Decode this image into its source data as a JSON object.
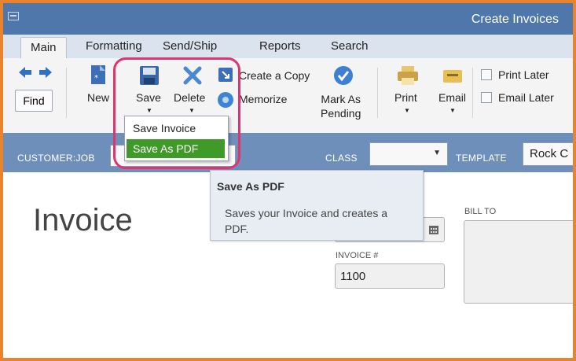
{
  "window": {
    "title": "Create Invoices"
  },
  "tabs": [
    {
      "label": "Main"
    },
    {
      "label": "Formatting"
    },
    {
      "label": "Send/Ship"
    },
    {
      "label": "Reports"
    },
    {
      "label": "Search"
    }
  ],
  "ribbon": {
    "find": "Find",
    "new": "New",
    "save": "Save",
    "delete": "Delete",
    "create_copy": "Create a Copy",
    "memorize": "Memorize",
    "mark_as_pending": [
      "Mark As",
      "Pending"
    ],
    "print": "Print",
    "email": "Email",
    "print_later": "Print Later",
    "email_later": "Email Later"
  },
  "save_menu": {
    "items": [
      {
        "label": "Save Invoice"
      },
      {
        "label": "Save As PDF"
      }
    ],
    "highlighted": "Save As PDF"
  },
  "tooltip": {
    "title": "Save As PDF",
    "body": "Saves your Invoice and creates a PDF."
  },
  "header": {
    "customer_job_label": "CUSTOMER:JOB",
    "class_label": "CLASS",
    "class_value": "",
    "template_label": "TEMPLATE",
    "template_value": "Rock C"
  },
  "form": {
    "title": "Invoice",
    "bill_to_label": "BILL TO",
    "invoice_num_label": "INVOICE #",
    "invoice_num_value": "1100"
  },
  "colors": {
    "border_orange": "#e8832e",
    "titlebar_blue": "#4f77ab",
    "menu_highlight_green": "#3f9a29",
    "callout_pink": "#e0346e"
  }
}
